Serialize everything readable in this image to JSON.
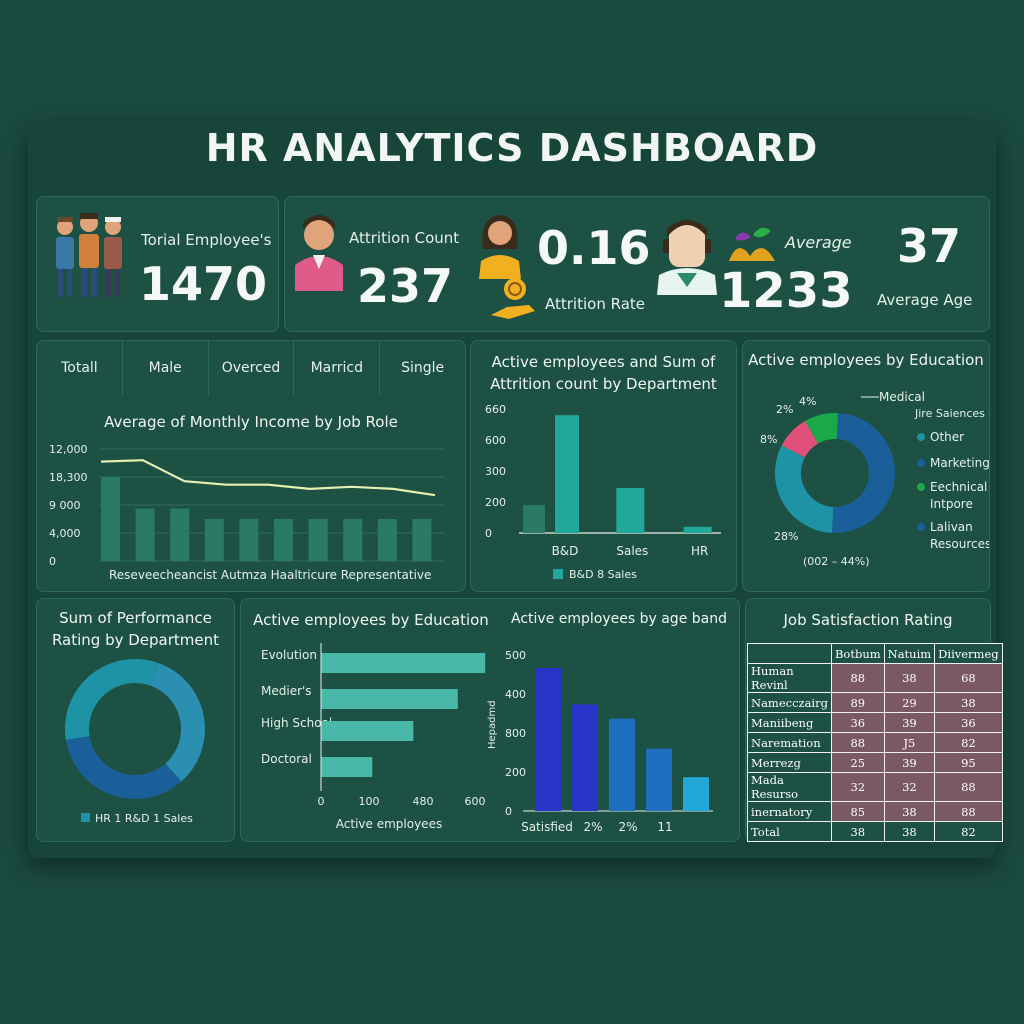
{
  "title": "HR ANALYTICS DASHBOARD",
  "kpis": {
    "total_label": "Torial Employee's",
    "total_value": "1470",
    "attrition_count_label": "Attrition Count",
    "attrition_count_value": "237",
    "attrition_rate_value": "0.16",
    "attrition_rate_label": "Attrition Rate",
    "average_label": "Average",
    "average_value": "1233",
    "average_age_value": "37",
    "average_age_label": "Average Age"
  },
  "filters": [
    "Totall",
    "Male",
    "Overced",
    "Marricd",
    "Single"
  ],
  "colors": {
    "line": "#e6f0b0",
    "bar_dark": "#2a7a66",
    "bar_teal": "#22a89a",
    "donut_blue": "#1a5f9a",
    "donut_teal": "#1f93a6",
    "donut_pink": "#e0507a",
    "donut_green": "#1aa84a",
    "age_blue": "#2835c8",
    "age_mid": "#1f6fc0",
    "age_light": "#22a8d8"
  },
  "chart_data": [
    {
      "id": "income",
      "type": "line",
      "title": "Average of Monthly Income by Job Role",
      "yticks": [
        "12,000",
        "18,300",
        "9 000",
        "4,000",
        "0"
      ],
      "ylim": [
        0,
        16000
      ],
      "x_labels": "Reseveecheancist  Autmza  Haaltricure  Representative",
      "bar_values": [
        12000,
        7500,
        7500,
        6000,
        6000,
        6000,
        6000,
        6000,
        6000,
        6000
      ],
      "line_values": [
        14200,
        14400,
        11400,
        10900,
        10900,
        10300,
        10600,
        10300,
        9400
      ]
    },
    {
      "id": "dept",
      "type": "bar",
      "title_line1": "Active employees and Sum of",
      "title_line2": "Attrition count by Department",
      "yticks": [
        "660",
        "600",
        "300",
        "200",
        "0"
      ],
      "ylim": [
        0,
        800
      ],
      "categories": [
        "B&D",
        "Sales",
        "HR"
      ],
      "series": [
        {
          "values": [
            180,
            0,
            0
          ]
        },
        {
          "values": [
            760,
            290,
            40
          ]
        }
      ],
      "legend": "B&D  8 Sales"
    },
    {
      "id": "edu-donut",
      "type": "pie",
      "title": "Active employees by Education",
      "slices": [
        {
          "label": "Medical",
          "value": 44
        },
        {
          "label": "Jire Saiences",
          "value": 28
        },
        {
          "label": "Other",
          "value": 8
        },
        {
          "label": "Marketing",
          "value": 8
        }
      ],
      "labels": {
        "top": "4%",
        "left_top": "2%",
        "left_mid": "8%",
        "left_bottom": "28%",
        "bottom": "(002 – 44%)"
      },
      "legend": [
        "Other",
        "Marketing",
        "Eechnical Intpore",
        "Lalivan Resources"
      ],
      "callouts": [
        "Medical",
        "Jire Saiences"
      ]
    },
    {
      "id": "perf-donut",
      "type": "pie",
      "title_line1": "Sum of Performance",
      "title_line2": "Rating by Department",
      "slices": [
        {
          "label": "HR",
          "value": 33
        },
        {
          "label": "R&D",
          "value": 33
        },
        {
          "label": "Sales",
          "value": 34
        }
      ],
      "legend": "HR 1 R&D   1 Sales"
    },
    {
      "id": "edu-bar",
      "type": "bar",
      "title": "Active employees by Education",
      "categories": [
        "Evolution",
        "Medier's",
        "High School",
        "Doctoral"
      ],
      "values": [
        480,
        400,
        270,
        150
      ],
      "xticks": [
        "0",
        "100",
        "480",
        "600"
      ],
      "xlabel": "Active employees"
    },
    {
      "id": "age-band",
      "type": "bar",
      "title": "Active employees by age band",
      "yticks": [
        "500",
        "400",
        "800",
        "200",
        "0"
      ],
      "ylim": [
        0,
        600
      ],
      "ylabel": "Hepadmd",
      "categories": [
        "Satisfied",
        "2%",
        "2%",
        "11"
      ],
      "values": [
        550,
        410,
        355,
        240,
        130
      ]
    },
    {
      "id": "job-sat",
      "type": "table",
      "title": "Job Satisfaction Rating",
      "columns": [
        "",
        "Botbum",
        "Natuim",
        "Diivermeg"
      ],
      "rows": [
        [
          "Human Revinl",
          "88",
          "38",
          "68"
        ],
        [
          "Namecczairg",
          "89",
          "29",
          "38"
        ],
        [
          "Maniibeng",
          "36",
          "39",
          "36"
        ],
        [
          "Naremation",
          "88",
          "J5",
          "82"
        ],
        [
          "Merrezg",
          "25",
          "39",
          "95"
        ],
        [
          "Mada Resurso",
          "32",
          "32",
          "88"
        ],
        [
          "inernatory",
          "85",
          "38",
          "88"
        ]
      ],
      "total": [
        "Total",
        "38",
        "38",
        "82"
      ]
    }
  ]
}
